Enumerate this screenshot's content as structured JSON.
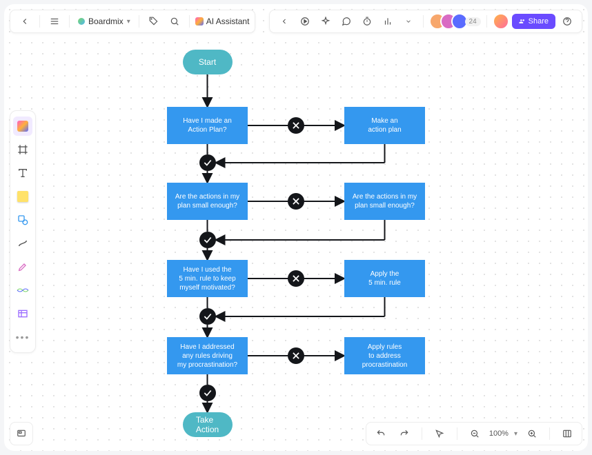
{
  "app": {
    "brand": "Boardmix",
    "ai_label": "AI Assistant"
  },
  "presence": {
    "count": "24"
  },
  "share": {
    "label": "Share"
  },
  "zoom": {
    "value": "100%"
  },
  "chart_data": {
    "type": "flowchart",
    "start": "Start",
    "end": "Take\nAction",
    "rows": [
      {
        "question": "Have I made an\nAction Plan?",
        "remedy": "Make an\naction plan"
      },
      {
        "question": "Are the actions in my\nplan small enough?",
        "remedy": "Are the actions in my\nplan small enough?"
      },
      {
        "question": "Have I used the\n5 min. rule to keep\nmyself motivated?",
        "remedy": "Apply the\n5 min. rule"
      },
      {
        "question": "Have I addressed\nany rules driving\nmy procrastination?",
        "remedy": "Apply rules\nto address\nprocrastination"
      }
    ]
  }
}
